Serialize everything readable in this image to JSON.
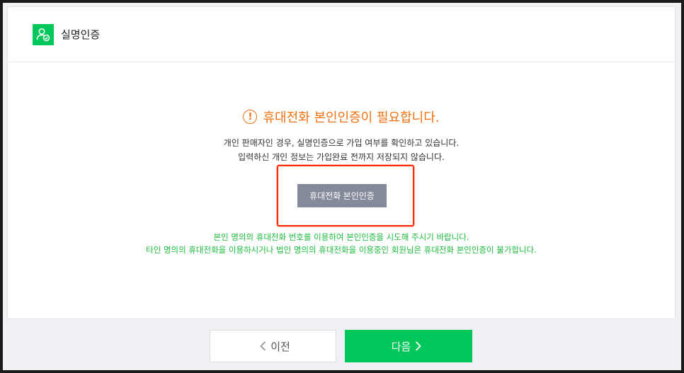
{
  "header": {
    "title": "실명인증"
  },
  "alert": {
    "title": "휴대전화 본인인증이 필요합니다."
  },
  "description": {
    "line1": "개인 판매자인 경우, 실명인증으로 가입 여부를 확인하고 있습니다.",
    "line2": "입력하신 개인 정보는 가입완료 전까지 저장되지 않습니다."
  },
  "cert_button": {
    "label": "휴대전화 본인인증"
  },
  "notice": {
    "line1": "본인 명의의 휴대전화 번호를 이용하여 본인인증을 시도해 주시기 바랍니다.",
    "line2": "타인 명의의 휴대전화을 이용하시거나 법인 명의의 휴대전화을 이용중인 회원님은 휴대전화 본인인증이 불가합니다."
  },
  "footer": {
    "prev_label": "이전",
    "next_label": "다음"
  },
  "icons": {
    "header": "user-check-icon",
    "alert": "exclamation-circle-icon",
    "prev": "chevron-left-icon",
    "next": "chevron-right-icon"
  },
  "colors": {
    "brand_green": "#03c75a",
    "alert_orange": "#f07010",
    "notice_green": "#1dbb3d",
    "cert_button": "#848a99",
    "highlight_red": "#ff2a00"
  }
}
